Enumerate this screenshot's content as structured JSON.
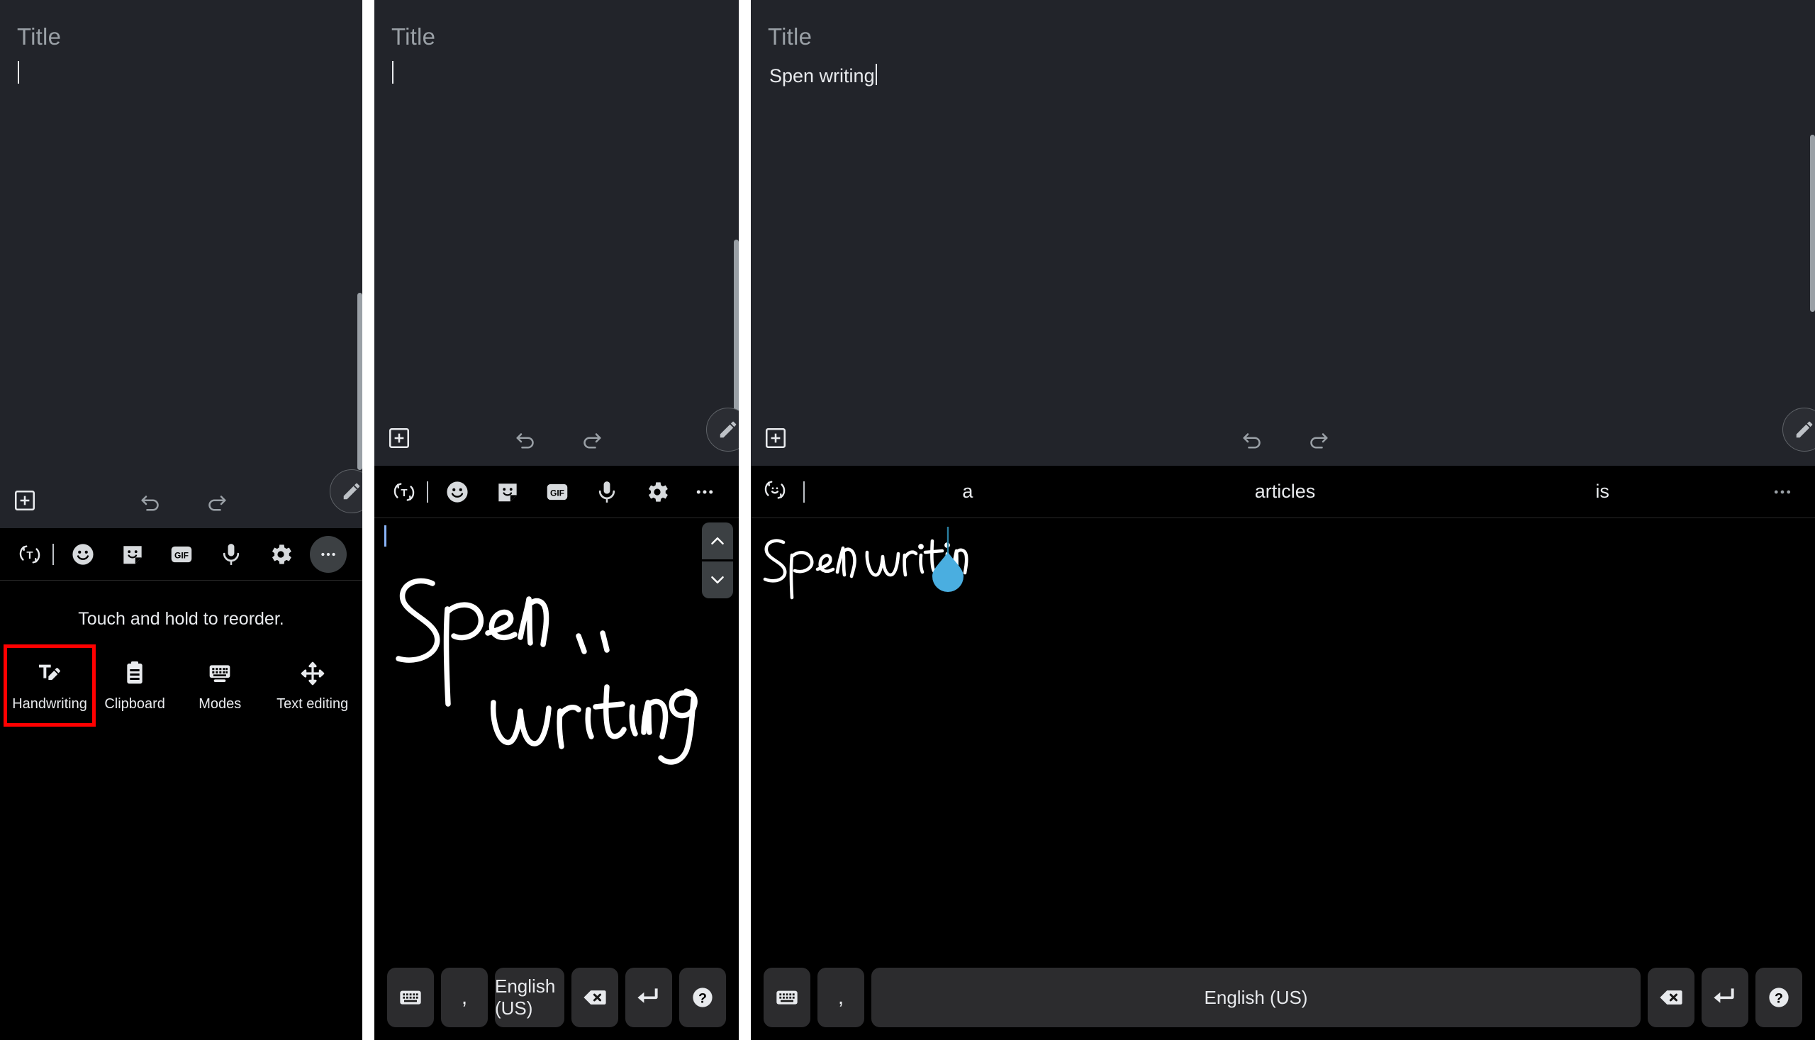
{
  "app": {
    "note_title_placeholder": "Title",
    "keyboard_language": "English (US)"
  },
  "panels": [
    {
      "id": "panel-keyboard-more-menu",
      "note": {
        "title_placeholder": "Title",
        "body_text": ""
      },
      "note_toolbar": {
        "add_label": "add-content",
        "undo_label": "undo",
        "redo_label": "redo",
        "overflow_label": "more-options",
        "pen_label": "pen"
      },
      "keyboard_toolbar": {
        "items": [
          {
            "name": "rotate-text-icon",
            "label": "Toggle text"
          },
          {
            "name": "emoji-icon",
            "label": "Emoji"
          },
          {
            "name": "sticker-icon",
            "label": "Stickers"
          },
          {
            "name": "gif-icon",
            "label": "GIF"
          },
          {
            "name": "microphone-icon",
            "label": "Voice input"
          },
          {
            "name": "gear-icon",
            "label": "Settings"
          },
          {
            "name": "more-icon",
            "label": "More"
          }
        ]
      },
      "more_menu": {
        "hint": "Touch and hold to reorder.",
        "items": [
          {
            "label": "Handwriting",
            "icon": "handwriting-icon",
            "selected": true
          },
          {
            "label": "Clipboard",
            "icon": "clipboard-icon",
            "selected": false
          },
          {
            "label": "Modes",
            "icon": "modes-icon",
            "selected": false
          },
          {
            "label": "Text editing",
            "icon": "text-editing-icon",
            "selected": false
          }
        ]
      }
    },
    {
      "id": "panel-handwriting-input",
      "note": {
        "title_placeholder": "Title",
        "body_text": ""
      },
      "note_toolbar": {
        "add_label": "add-content",
        "undo_label": "undo",
        "redo_label": "redo",
        "overflow_label": "more-options",
        "pen_label": "pen"
      },
      "keyboard_toolbar": {
        "items": [
          {
            "name": "rotate-text-icon",
            "label": "Toggle text"
          },
          {
            "name": "emoji-icon",
            "label": "Emoji"
          },
          {
            "name": "sticker-icon",
            "label": "Stickers"
          },
          {
            "name": "gif-icon",
            "label": "GIF"
          },
          {
            "name": "microphone-icon",
            "label": "Voice input"
          },
          {
            "name": "gear-icon",
            "label": "Settings"
          },
          {
            "name": "more-icon",
            "label": "More"
          }
        ]
      },
      "handwriting": {
        "ink_text": "Spen writing",
        "has_teardrop": false
      },
      "key_row": {
        "keyboard_key": "keyboard-icon",
        "comma_key": ",",
        "space_key": "English (US)",
        "backspace_key": "backspace-icon",
        "enter_key": "enter-icon",
        "help_key": "help-icon"
      }
    },
    {
      "id": "panel-handwriting-converted",
      "note": {
        "title_placeholder": "Title",
        "body_text": "Spen writing"
      },
      "note_toolbar": {
        "add_label": "add-content",
        "undo_label": "undo",
        "redo_label": "redo",
        "overflow_label": "more-options",
        "pen_label": "pen"
      },
      "suggestions": {
        "swap_icon": "emoji-swap-icon",
        "words": [
          "a",
          "articles",
          "is"
        ],
        "more": "more-icon"
      },
      "handwriting": {
        "ink_text": "Spen writing",
        "has_teardrop": true
      },
      "key_row": {
        "keyboard_key": "keyboard-icon",
        "comma_key": ",",
        "space_key": "English (US)",
        "backspace_key": "backspace-icon",
        "enter_key": "enter-icon",
        "help_key": "help-icon"
      }
    }
  ],
  "colors": {
    "note_bg": "#22242a",
    "keyboard_bg": "#000000",
    "key_bg": "#2c2c2e",
    "text_primary": "#e8eaed",
    "text_secondary": "#9aa0a6",
    "highlight_red": "#ff0000",
    "cursor_blue": "#4aaee0"
  }
}
